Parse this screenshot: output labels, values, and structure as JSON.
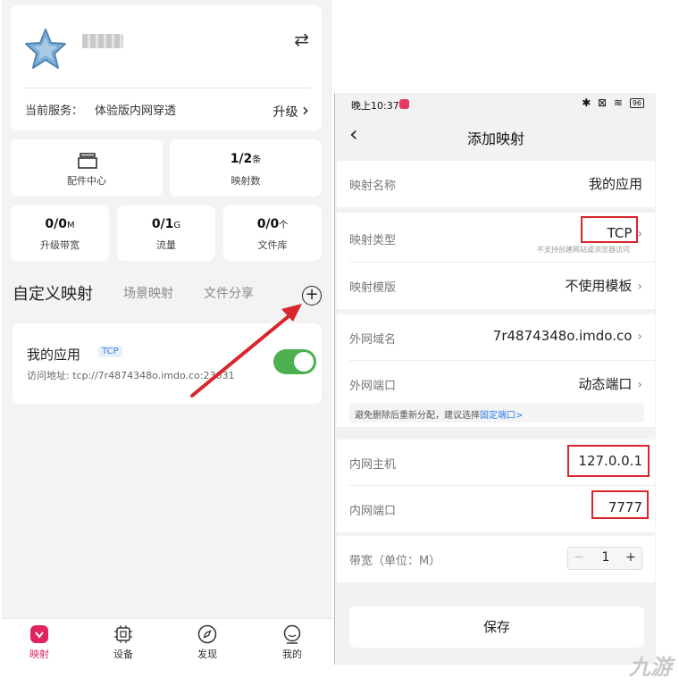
{
  "left_app": {
    "profile": {
      "swap_icon": "⇄",
      "service_label": "当前服务：",
      "service_value": "体验版内网穿透",
      "upgrade_label": "升级",
      "chevron": "›"
    },
    "stats_top": [
      {
        "value": "",
        "label": "配件中心",
        "icon": "box-icon"
      },
      {
        "value": "1/2",
        "unit": "条",
        "label": "映射数"
      }
    ],
    "stats_bottom": [
      {
        "value": "0/0",
        "unit": "M",
        "label": "升级带宽"
      },
      {
        "value": "0/1",
        "unit": "G",
        "label": "流量"
      },
      {
        "value": "0/0",
        "unit": "个",
        "label": "文件库"
      }
    ],
    "tabs": [
      {
        "label": "自定义映射"
      },
      {
        "label": "场景映射"
      },
      {
        "label": "文件分享"
      }
    ],
    "plus": "+",
    "mapping": {
      "name": "我的应用",
      "badge": "TCP",
      "address": "访问地址: tcp://7r4874348o.imdo.co:23031"
    },
    "bottom_nav": [
      {
        "label": "映射",
        "icon": "mapping-icon"
      },
      {
        "label": "设备",
        "icon": "device-icon"
      },
      {
        "label": "发现",
        "icon": "compass-icon"
      },
      {
        "label": "我的",
        "icon": "profile-icon"
      }
    ],
    "colors": {
      "accent": "#e0245e",
      "toggle_on": "#4caf50",
      "arrow": "#d9252c"
    }
  },
  "right_app": {
    "status": {
      "time": "晚上10:37",
      "icons": "✱ ⊠ ≋",
      "battery": "96"
    },
    "back": "‹",
    "title": "添加映射",
    "fields": {
      "mapping_name": {
        "label": "映射名称",
        "value": "我的应用"
      },
      "mapping_type": {
        "label": "映射类型",
        "value": "TCP",
        "sub": "不支持创建网站或浏览器访问"
      },
      "mapping_template": {
        "label": "映射模版",
        "value": "不使用模板"
      },
      "external_domain": {
        "label": "外网域名",
        "value": "7r4874348o.imdo.co"
      },
      "external_port": {
        "label": "外网端口",
        "value": "动态端口"
      },
      "hint": {
        "text": "避免删除后重新分配，建议选择",
        "link": "固定端口>"
      },
      "internal_host": {
        "label": "内网主机",
        "value": "127.0.0.1"
      },
      "internal_port": {
        "label": "内网端口",
        "value": "7777"
      },
      "bandwidth": {
        "label": "带宽（单位：M）",
        "minus": "−",
        "value": "1",
        "plus": "+"
      }
    },
    "chevron": "›",
    "save_label": "保存"
  },
  "watermark": "九游"
}
